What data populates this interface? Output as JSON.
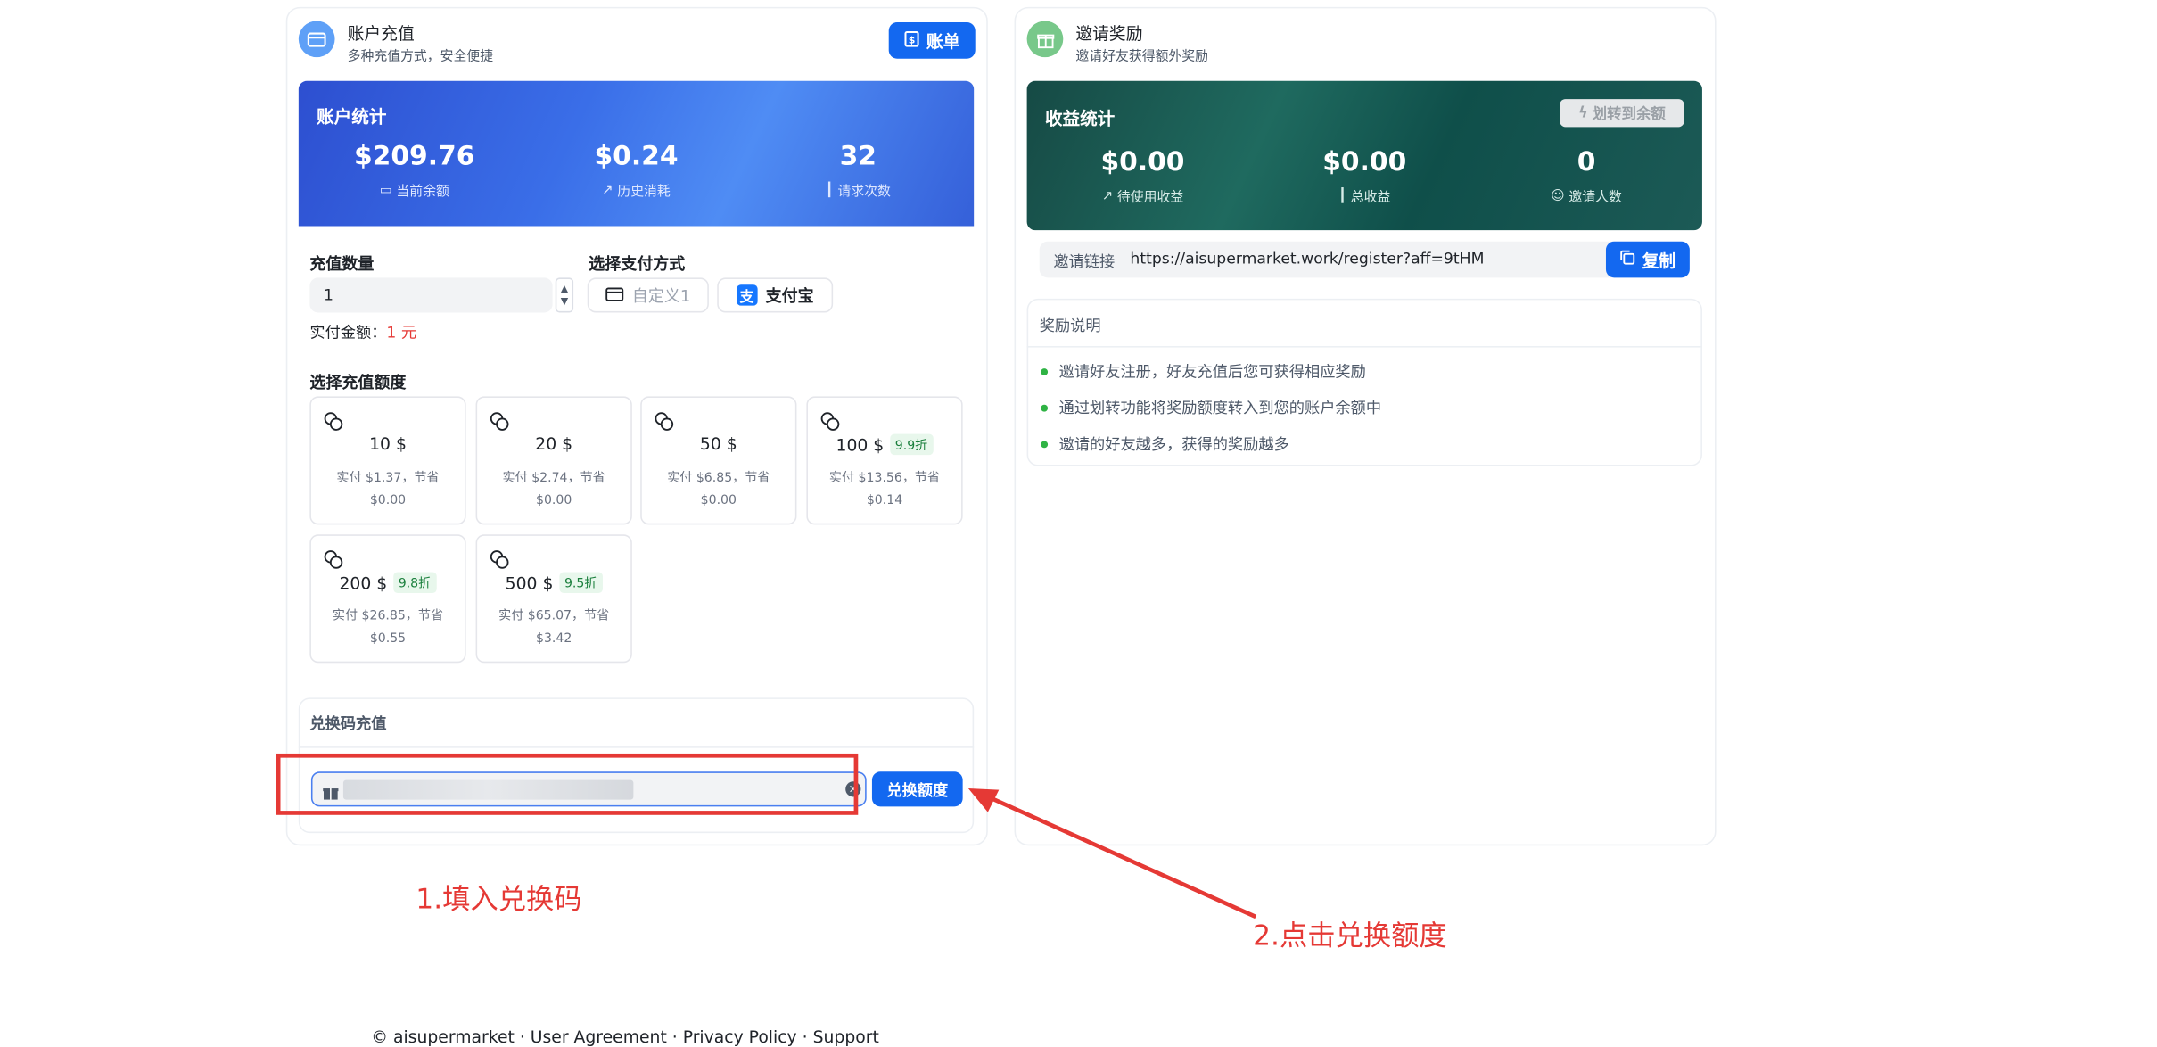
{
  "recharge": {
    "title": "账户充值",
    "subtitle": "多种充值方式，安全便捷",
    "bill_button": "账单",
    "stats_title": "账户统计",
    "stats": [
      {
        "value": "$209.76",
        "label": "当前余额",
        "icon": "wallet-icon"
      },
      {
        "value": "$0.24",
        "label": "历史消耗",
        "icon": "trend-up-icon"
      },
      {
        "value": "32",
        "label": "请求次数",
        "icon": "bar-chart-icon"
      }
    ],
    "qty_label": "充值数量",
    "qty_value": "1",
    "pay_label": "选择支付方式",
    "pay_custom": "自定义1",
    "pay_alipay": "支付宝",
    "actual_label": "实付金额：",
    "actual_value": "1 元",
    "amount_label": "选择充值额度",
    "amounts": [
      {
        "amount": "10 $",
        "discount": "",
        "line1": "实付 $1.37，节省",
        "line2": "$0.00"
      },
      {
        "amount": "20 $",
        "discount": "",
        "line1": "实付 $2.74，节省",
        "line2": "$0.00"
      },
      {
        "amount": "50 $",
        "discount": "",
        "line1": "实付 $6.85，节省",
        "line2": "$0.00"
      },
      {
        "amount": "100 $",
        "discount": "9.9折",
        "line1": "实付 $13.56，节省",
        "line2": "$0.14"
      },
      {
        "amount": "200 $",
        "discount": "9.8折",
        "line1": "实付 $26.85，节省",
        "line2": "$0.55"
      },
      {
        "amount": "500 $",
        "discount": "9.5折",
        "line1": "实付 $65.07，节省",
        "line2": "$3.42"
      }
    ],
    "redeem_title": "兑换码充值",
    "redeem_button": "兑换额度"
  },
  "invite": {
    "title": "邀请奖励",
    "subtitle": "邀请好友获得额外奖励",
    "stats_title": "收益统计",
    "transfer_button": "划转到余额",
    "stats": [
      {
        "value": "$0.00",
        "label": "待使用收益"
      },
      {
        "value": "$0.00",
        "label": "总收益"
      },
      {
        "value": "0",
        "label": "邀请人数"
      }
    ],
    "link_label": "邀请链接",
    "link_value": "https://aisupermarket.work/register?aff=9tHM",
    "copy_button": "复制",
    "reward_title": "奖励说明",
    "rewards": [
      "邀请好友注册，好友充值后您可获得相应奖励",
      "通过划转功能将奖励额度转入到您的账户余额中",
      "邀请的好友越多，获得的奖励越多"
    ]
  },
  "annotations": {
    "step1": "1.填入兑换码",
    "step2": "2.点击兑换额度"
  },
  "footer": "© aisupermarket · User Agreement · Privacy Policy · Support",
  "colors": {
    "primary": "#1368f0",
    "annotation": "#e53935",
    "price": "#e53935"
  }
}
